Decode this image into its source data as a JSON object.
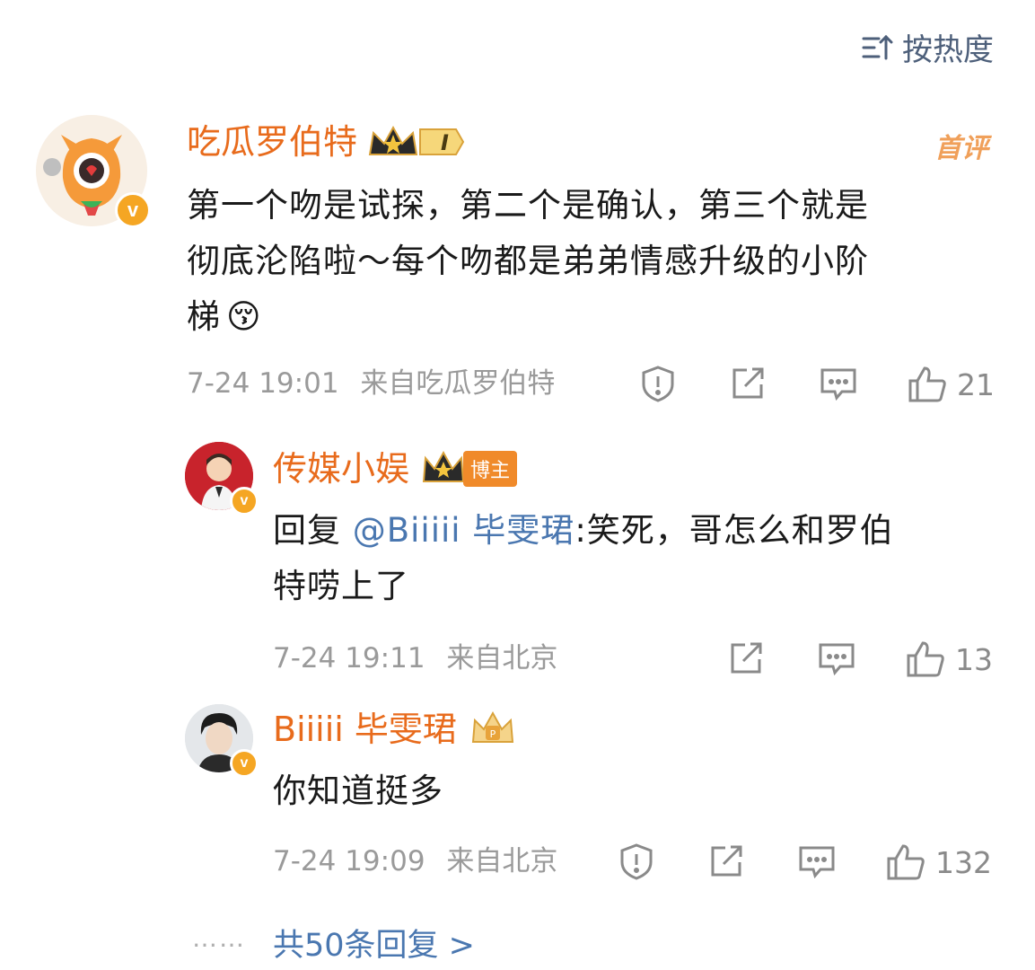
{
  "sort": {
    "label": "按热度"
  },
  "comments": [
    {
      "username": "吃瓜罗伯特",
      "level": "I",
      "badge": "首评",
      "text_line1": "第一个吻是试探，第二个是确认，第三个就是",
      "text_line2": "彻底沦陷啦～每个吻都是弟弟情感升级的小阶",
      "text_line3": "梯",
      "emoji": "😚",
      "time": "7-24 19:01",
      "source": "来自吃瓜罗伯特",
      "likes": "21"
    },
    {
      "username": "传媒小娱",
      "tag": "博主",
      "reply_prefix": "回复 ",
      "mention": "@Biiiii 毕雯珺",
      "text_after_mention": ":笑死，哥怎么和罗伯",
      "text_line2": "特唠上了",
      "time": "7-24 19:11",
      "source": "来自北京",
      "likes": "13"
    },
    {
      "username": "Biiiii 毕雯珺",
      "text": "你知道挺多",
      "time": "7-24 19:09",
      "source": "来自北京",
      "likes": "132"
    }
  ],
  "more_replies": {
    "dots": "……",
    "label": "共50条回复 >"
  },
  "colors": {
    "username": "#e86b1c",
    "mention": "#4a77b0",
    "meta": "#9a9a9a",
    "verified": "#f5a623"
  },
  "icons": [
    "sort-icon",
    "crown-icon",
    "report-icon",
    "share-icon",
    "comment-icon",
    "like-icon"
  ]
}
